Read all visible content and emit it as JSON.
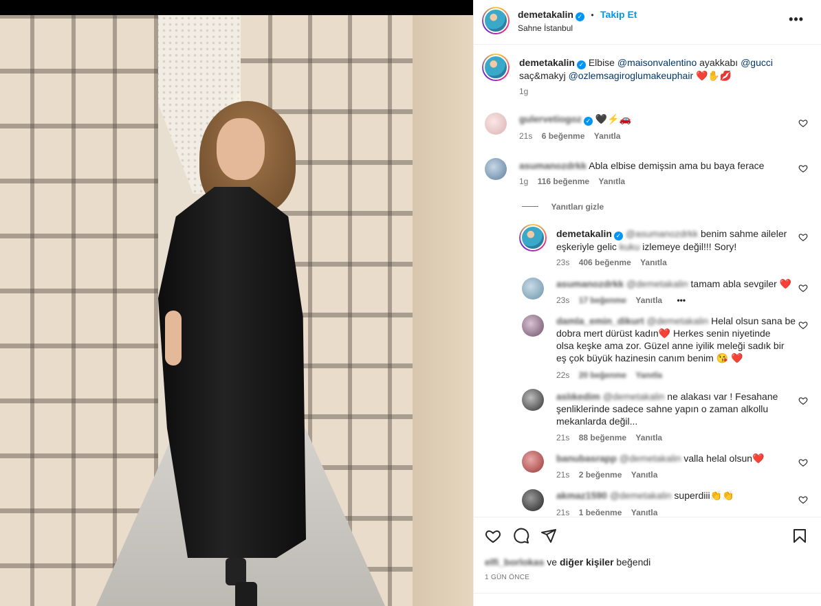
{
  "post": {
    "username": "demetakalin",
    "follow_label": "Takip Et",
    "separator": "•",
    "location": "Sahne İstanbul",
    "more_label": "•••"
  },
  "caption": {
    "username": "demetakalin",
    "t1": "Elbise ",
    "m1": "@maisonvalentino",
    "t2": " ayakkabı ",
    "m2": "@gucci",
    "t3": "saç&makyj ",
    "m3": "@ozlemsagiroglumakeuphair",
    "emoji": "❤️✋💋",
    "time": "1g"
  },
  "comments": [
    {
      "user": "gulervetiogoz",
      "text": "🖤⚡🚗",
      "time": "21s",
      "likes": "6 beğenme",
      "reply": "Yanıtla"
    },
    {
      "user": "asumanozdrkk",
      "text": "Abla elbise demişsin ama bu baya ferace",
      "time": "1g",
      "likes": "116 beğenme",
      "reply": "Yanıtla"
    }
  ],
  "hide_replies": "Yanıtları gizle",
  "replies": [
    {
      "user": "demetakalin",
      "mention": "@asumanozdrkk",
      "text_a": " benim sahme aileler",
      "text_b": "eşkeriyle gelic",
      "blur_word": "kuku",
      "text_c": " izlemeye değil!!! Sory!",
      "time": "23s",
      "likes": "406 beğenme",
      "reply": "Yanıtla"
    },
    {
      "user": "asumanozdrkk",
      "mention": "@demetakalin",
      "text": " tamam abla sevgiler ❤️",
      "time": "23s",
      "likes": "17 beğenme",
      "reply": "Yanıtla",
      "more": "•••"
    },
    {
      "user": "damla_emin_dikurt",
      "mention": "@demetakalin",
      "line1": " Helal olsun sana be",
      "line2": "dobra mert dürüst kadın❤️ Herkes senin niyetinde",
      "line3": "olsa keşke ama zor. Güzel anne iyilik meleği sadık bir",
      "line4": "eş çok büyük hazinesin canım benim 😘 ❤️",
      "time": "22s",
      "likes": "20 beğenme",
      "reply": "Yanıtla"
    },
    {
      "user": "aslıkedim",
      "mention": "@demetakalin",
      "line1": " ne alakası var ! Fesahane",
      "line2": "şenliklerinde sadece sahne yapın o zaman alkollu",
      "line3": "mekanlarda değil...",
      "time": "21s",
      "likes": "88 beğenme",
      "reply": "Yanıtla"
    },
    {
      "user": "banubasrapp",
      "mention": "@demetakalin",
      "text": " valla helal olsun❤️",
      "time": "21s",
      "likes": "2 beğenme",
      "reply": "Yanıtla"
    },
    {
      "user": "akmaz1590",
      "mention": "@demetakalin",
      "text": " superdiii👏👏",
      "time": "21s",
      "likes": "1 beğenme",
      "reply": "Yanıtla"
    }
  ],
  "likes_line": {
    "users": "elfi_borlokas",
    "and": " ve ",
    "others": "diğer kişiler",
    "suffix": " beğendi"
  },
  "date": "1 GÜN ÖNCE",
  "icons": [
    "heart-icon",
    "comment-icon",
    "share-icon",
    "bookmark-icon"
  ]
}
